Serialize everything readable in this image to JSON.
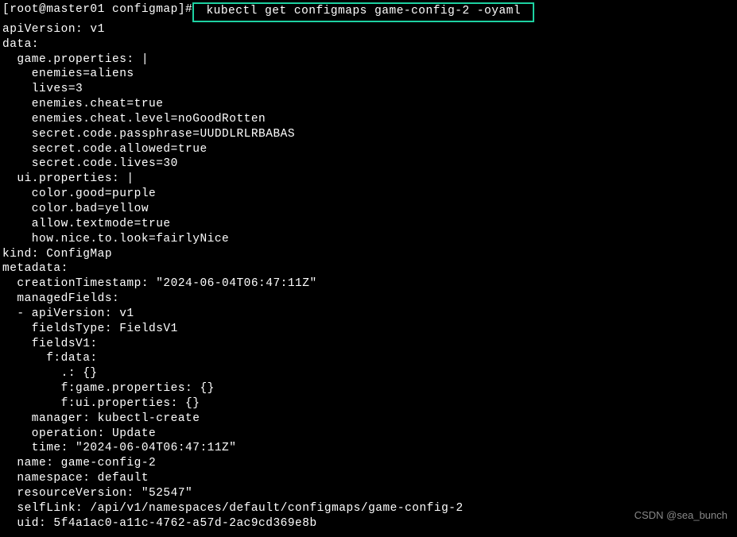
{
  "prompt": "[root@master01 configmap]#",
  "command": " kubectl get configmaps game-config-2 -oyaml ",
  "output_lines": [
    "apiVersion: v1",
    "data:",
    "  game.properties: |",
    "    enemies=aliens",
    "    lives=3",
    "    enemies.cheat=true",
    "    enemies.cheat.level=noGoodRotten",
    "    secret.code.passphrase=UUDDLRLRBABAS",
    "    secret.code.allowed=true",
    "    secret.code.lives=30",
    "  ui.properties: |",
    "    color.good=purple",
    "    color.bad=yellow",
    "    allow.textmode=true",
    "    how.nice.to.look=fairlyNice",
    "kind: ConfigMap",
    "metadata:",
    "  creationTimestamp: \"2024-06-04T06:47:11Z\"",
    "  managedFields:",
    "  - apiVersion: v1",
    "    fieldsType: FieldsV1",
    "    fieldsV1:",
    "      f:data:",
    "        .: {}",
    "        f:game.properties: {}",
    "        f:ui.properties: {}",
    "    manager: kubectl-create",
    "    operation: Update",
    "    time: \"2024-06-04T06:47:11Z\"",
    "  name: game-config-2",
    "  namespace: default",
    "  resourceVersion: \"52547\"",
    "  selfLink: /api/v1/namespaces/default/configmaps/game-config-2",
    "  uid: 5f4a1ac0-a11c-4762-a57d-2ac9cd369e8b"
  ],
  "watermark": "CSDN @sea_bunch"
}
